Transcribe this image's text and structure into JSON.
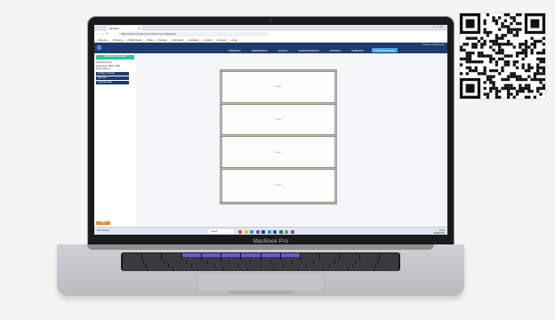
{
  "device": {
    "model_label": "MacBook Pro"
  },
  "browser": {
    "tab_title": "Mecalux",
    "url": "https://www.mecalux.com/shelving-configurator",
    "bookmarks": [
      "Mecalux",
      "Shelving",
      "Pallet Racks",
      "Blog",
      "Storage",
      "Calculator",
      "Catalogs",
      "Contact",
      "Support",
      "Help"
    ]
  },
  "app": {
    "logo_text": "Mecalux",
    "user_line": "Mecalux Configurator",
    "menu": [
      "Product",
      "Dimensions",
      "Levels",
      "Configuration",
      "Options",
      "Summary",
      "Configurator"
    ],
    "active_menu_index": 6
  },
  "sidebar": {
    "green_button": "Shelving Configurator",
    "info_lines": [
      "Selected product",
      "Dimensions: 2000 x 1200",
      "Depth: 600 mm"
    ],
    "buttons": [
      "Configure shelving",
      "Add level",
      "Generate quote"
    ],
    "bottom_button": "Help"
  },
  "shelf": {
    "levels": [
      "Level 1",
      "Level 2",
      "Level 3",
      "Level 4"
    ]
  },
  "taskbar": {
    "weather": "25°C Sunny",
    "search_placeholder": "Search",
    "time": "10:42",
    "date": "14/06/2024"
  },
  "colors": {
    "header": "#1e3a6e",
    "accent_green": "#2fc3a1",
    "accent_blue": "#4aa3df",
    "accent_orange": "#e98a28"
  },
  "icons": [
    "chrome-icon",
    "folder-icon",
    "mail-icon",
    "teams-icon",
    "store-icon",
    "edge-icon",
    "word-icon",
    "excel-icon",
    "settings-icon",
    "photos-icon"
  ]
}
